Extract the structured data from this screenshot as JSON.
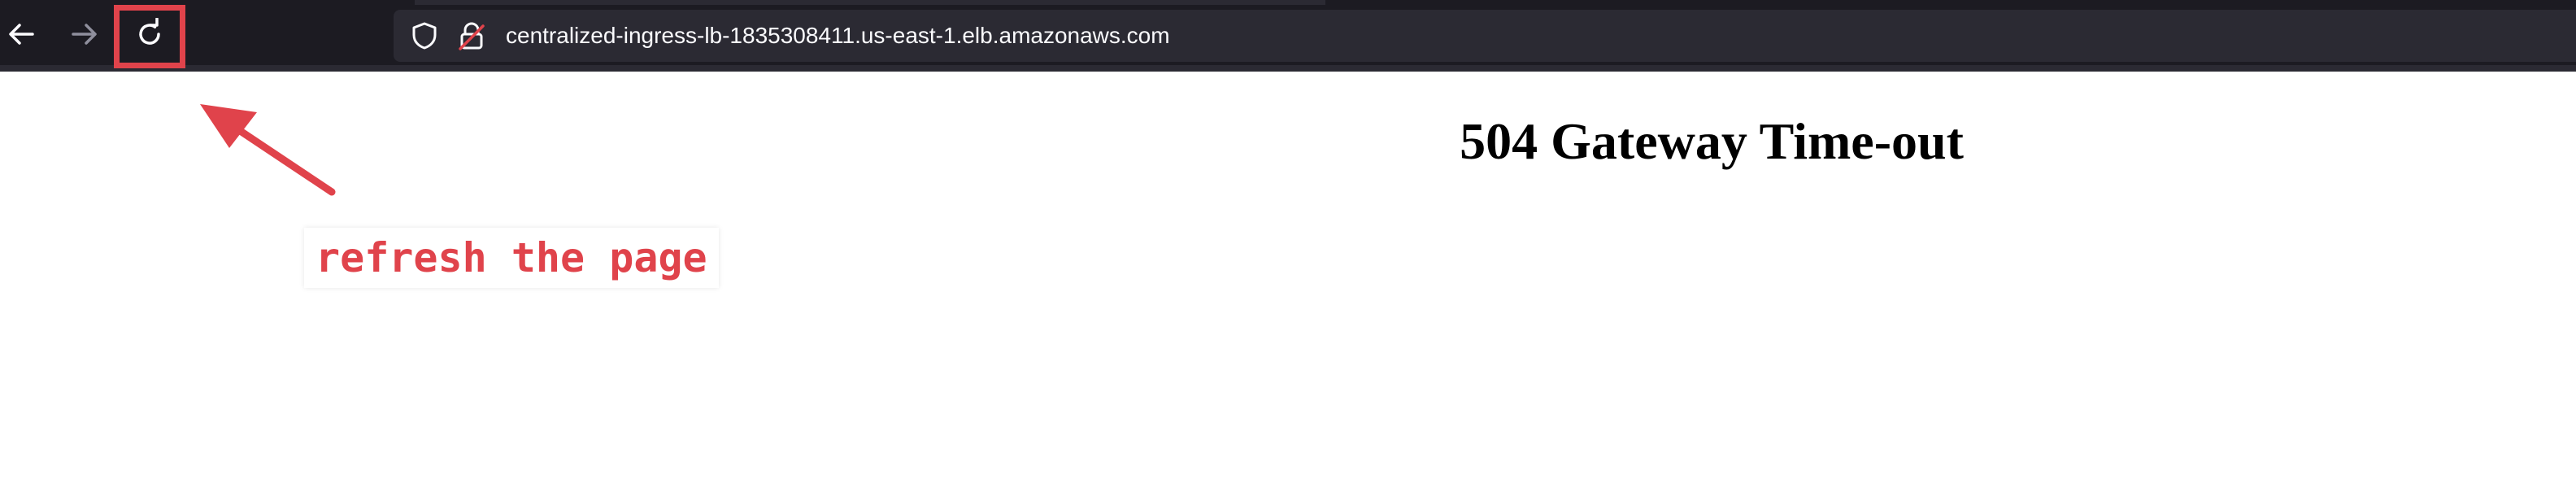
{
  "browser": {
    "address_bar": {
      "url": "centralized-ingress-lb-1835308411.us-east-1.elb.amazonaws.com"
    },
    "icons": {
      "back": "arrow-left-icon",
      "forward": "arrow-right-icon",
      "reload": "reload-icon",
      "tracking_protection": "shield-icon",
      "connection": "lock-warning-icon"
    },
    "forward_enabled": false
  },
  "page": {
    "heading": "504 Gateway Time-out"
  },
  "annotation": {
    "label": "refresh the page",
    "color": "#e0434b",
    "target": "reload-button"
  }
}
